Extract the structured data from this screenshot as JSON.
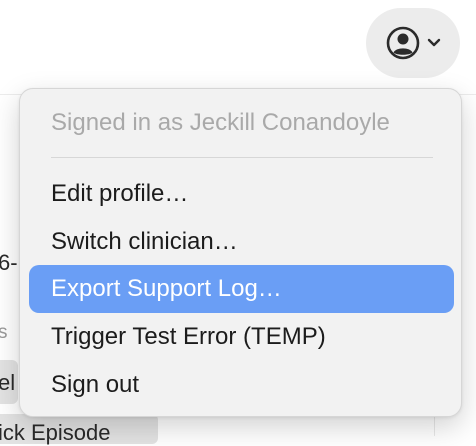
{
  "header": {
    "account_button": {
      "icon": "user-circle-icon",
      "caret_icon": "chevron-down-icon"
    }
  },
  "background": {
    "fragment_1": "6-",
    "fragment_2": "s",
    "fragment_3": "el",
    "fragment_4": "ick Episode"
  },
  "menu": {
    "signed_in_label": "Signed in as Jeckill Conandoyle",
    "items": [
      {
        "label": "Edit profile…"
      },
      {
        "label": "Switch clinician…"
      },
      {
        "label": "Export Support Log…",
        "highlighted": true
      },
      {
        "label": "Trigger Test Error (TEMP)"
      },
      {
        "label": "Sign out"
      }
    ]
  },
  "colors": {
    "highlight": "#6a9ef5",
    "menu_background": "#f2f2f2",
    "header_text": "#a9a9a9"
  }
}
